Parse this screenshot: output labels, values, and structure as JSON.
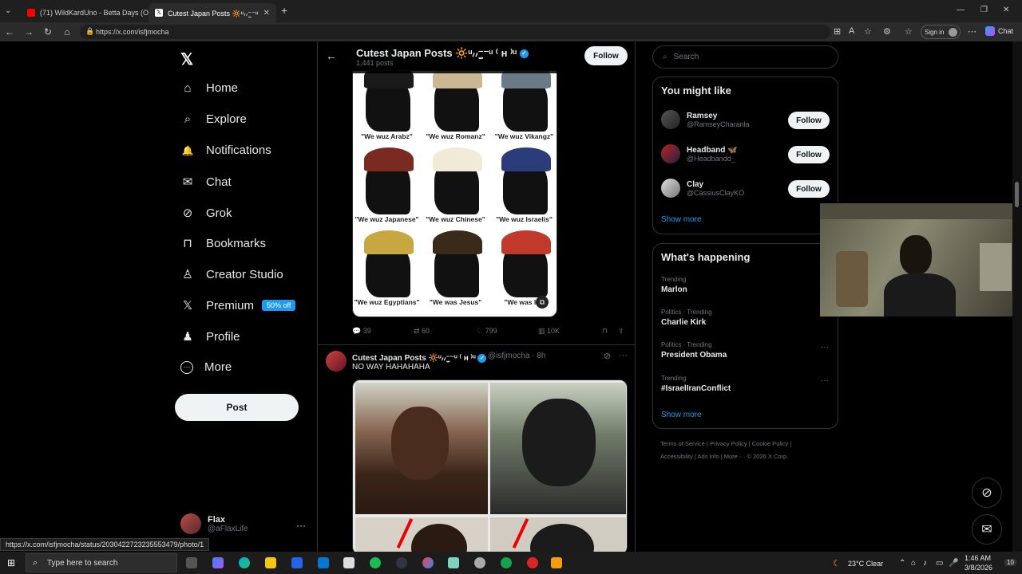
{
  "browser": {
    "tabs": [
      {
        "title": "(71) WildKardUno - Betta Days (O",
        "fav_color": "#ff0000",
        "active": false
      },
      {
        "title": "Cutest Japan Posts 🔆ᵘ៸៸⁻̫⁻ᵘ ⁽ ʜ ⁾ᵘ",
        "fav_color": "#ffffff",
        "active": true
      }
    ],
    "new_tab": "+",
    "url": "https://x.com/isfjmocha",
    "sign_in": "Sign in",
    "chat": "Chat",
    "window_controls": [
      "—",
      "❐",
      "✕"
    ]
  },
  "nav": {
    "logo": "𝕏",
    "items": [
      {
        "icon": "⌂",
        "label": "Home"
      },
      {
        "icon": "⌕",
        "label": "Explore"
      },
      {
        "icon": "🔔",
        "label": "Notifications"
      },
      {
        "icon": "✉",
        "label": "Chat"
      },
      {
        "icon": "⊘",
        "label": "Grok"
      },
      {
        "icon": "⊓",
        "label": "Bookmarks"
      },
      {
        "icon": "♙",
        "label": "Creator Studio"
      },
      {
        "icon": "𝕏",
        "label": "Premium",
        "badge": "50% off"
      },
      {
        "icon": "♟",
        "label": "Profile"
      },
      {
        "icon": "⋯",
        "label": "More"
      }
    ],
    "post_button": "Post",
    "account": {
      "name": "Flax",
      "handle": "@aFlaxLife",
      "more": "···"
    }
  },
  "header": {
    "back": "←",
    "title": "Cutest Japan Posts 🔆ᵘ៸៸⁻̫⁻ᵘ ⁽ ʜ ⁾ᵘ",
    "verified": "✓",
    "posts_count": "1,441 posts",
    "follow": "Follow"
  },
  "tweet1": {
    "captions": [
      "\"We wuz Arabz\"",
      "\"We wuz Romanz\"",
      "\"We wuz Vikangz\"",
      "\"We wuz Japanese\"",
      "\"We wuz Chinese\"",
      "\"We wuz Israelis\"",
      "\"We wuz Egyptians\"",
      "\"We was Jesus\"",
      "\"We was Ind"
    ],
    "hat_colors": [
      "#1a1a1a",
      "#c9b892",
      "#6b7a87",
      "#7a2a20",
      "#f1ead6",
      "#2a3d7a",
      "#c9a740",
      "#3a2a1a",
      "#c0392b"
    ],
    "actions": {
      "replies": "39",
      "reposts": "60",
      "likes": "799",
      "views": "10K"
    }
  },
  "tweet2": {
    "name": "Cutest Japan Posts 🔆ᵘ៸៸⁻̫⁻ᵘ ⁽ ʜ ⁾ᵘ",
    "verified": "✓",
    "handle": "@isfjmocha · 8h",
    "text": "NO WAY HAHAHAHA",
    "more": "···"
  },
  "right": {
    "search_placeholder": "Search",
    "might_like": {
      "title": "You might like",
      "users": [
        {
          "name": "Ramsey",
          "handle": "@RamseyCharanla",
          "follow": "Follow"
        },
        {
          "name": "Headband 🦋",
          "handle": "@Headbandd_",
          "follow": "Follow"
        },
        {
          "name": "Clay",
          "handle": "@CassiusClayKO",
          "follow": "Follow"
        }
      ],
      "show_more": "Show more"
    },
    "happening": {
      "title": "What's happening",
      "trends": [
        {
          "context": "Trending",
          "topic": "Marlon"
        },
        {
          "context": "Politics · Trending",
          "topic": "Charlie Kirk"
        },
        {
          "context": "Politics · Trending",
          "topic": "President Obama"
        },
        {
          "context": "Trending",
          "topic": "#IsraelIranConflict"
        }
      ],
      "show_more": "Show more"
    },
    "footer_line1": "Terms of Service  |  Privacy Policy  |  Cookie Policy  |",
    "footer_line2": "Accessibility  |  Ads info  |  More ···  © 2026 X Corp."
  },
  "status_url": "https://x.com/isfjmocha/status/2030422723235553479/photo/1",
  "taskbar": {
    "search_placeholder": "Type here to search",
    "weather": "23°C  Clear",
    "time": "1:46 AM",
    "date": "3/8/2026",
    "notif": "10"
  }
}
